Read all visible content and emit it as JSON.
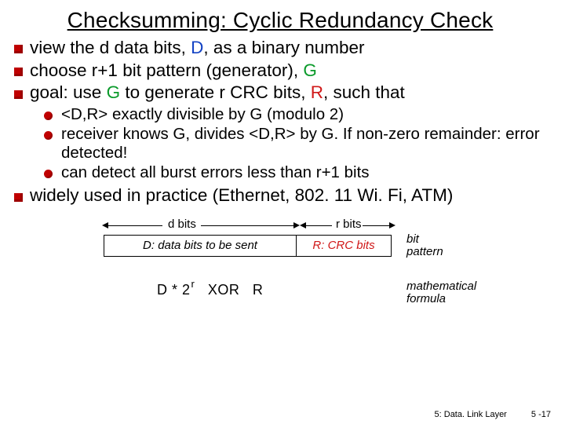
{
  "title": "Checksumming: Cyclic Redundancy Check",
  "b1": {
    "a": "view the d data bits, ",
    "D": "D",
    "b": ", as a binary number"
  },
  "b2": {
    "a": "choose r+1 bit pattern (generator), ",
    "G": "G"
  },
  "b3": {
    "a": "goal: use ",
    "G": "G",
    "b": " to generate r CRC bits, ",
    "R": "R",
    "c": ", such that"
  },
  "s1": " <D,R> exactly divisible by G (modulo 2)",
  "s2": "receiver knows G, divides <D,R> by G.  If non-zero remainder: error detected!",
  "s3": "can detect all burst errors less than r+1 bits",
  "b4": "widely used in practice (Ethernet, 802. 11 Wi. Fi, ATM)",
  "dg": {
    "dbits": "d bits",
    "rbits": "r bits",
    "boxD": "D: data bits to be sent",
    "boxR": "R: CRC bits",
    "bit1": "bit",
    "bit2": "pattern",
    "f1": "D * 2",
    "fr": "r",
    "f2": "   XOR   R",
    "m1": "mathematical",
    "m2": "formula"
  },
  "footer": {
    "chapter": "5: Data. Link Layer",
    "page": "5 -17"
  }
}
